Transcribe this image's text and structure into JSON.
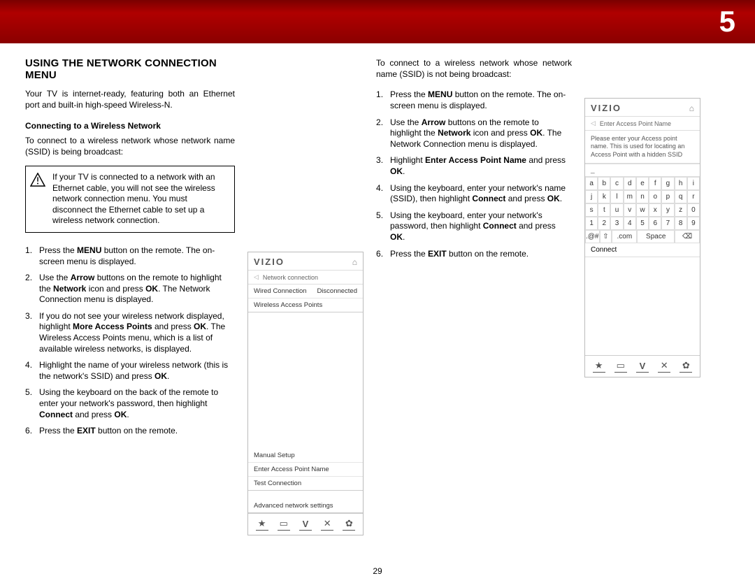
{
  "banner": {
    "chapter": "5"
  },
  "pageNumber": "29",
  "left": {
    "title": "USING THE NETWORK CONNECTION MENU",
    "intro": "Your TV is internet-ready, featuring both an Ethernet port and built-in high-speed Wireless-N.",
    "subhead": "Connecting to a Wireless Network",
    "lead": "To connect to a wireless network whose network name (SSID) is being broadcast:",
    "warning": "If your TV is connected to a network with an Ethernet cable, you will not see the wireless network connection menu. You must disconnect the Ethernet cable to set up a wireless network connection.",
    "steps": {
      "s1a": "Press the ",
      "s1b": "MENU",
      "s1c": " button on the remote. The on-screen menu is displayed.",
      "s2a": "Use the ",
      "s2b": "Arrow",
      "s2c": " buttons on the remote to highlight the ",
      "s2d": "Network",
      "s2e": " icon and press ",
      "s2f": "OK",
      "s2g": ". The Network Connection menu is displayed.",
      "s3a": "If you do not see your wireless network displayed, highlight ",
      "s3b": "More Access Points",
      "s3c": " and press ",
      "s3d": "OK",
      "s3e": ". The Wireless Access Points menu, which is a list of available wireless networks, is displayed.",
      "s4a": "Highlight the name of your wireless network (this is the network's SSID) and press ",
      "s4b": "OK",
      "s4c": ".",
      "s5a": "Using the keyboard on the back of the remote to enter your network's password, then highlight ",
      "s5b": "Connect",
      "s5c": " and press ",
      "s5d": "OK",
      "s5e": ".",
      "s6a": "Press the ",
      "s6b": "EXIT",
      "s6c": " button on the remote."
    }
  },
  "mid_menu": {
    "brand": "VIZIO",
    "crumb": "Network connection",
    "rows": {
      "wired_label": "Wired Connection",
      "wired_status": "Disconnected",
      "wireless": "Wireless Access Points"
    },
    "lower": {
      "manual": "Manual Setup",
      "enter_ap": "Enter Access Point Name",
      "test": "Test Connection",
      "advanced": "Advanced network settings"
    }
  },
  "right": {
    "lead": "To connect to a wireless network whose network name (SSID) is not being broadcast:",
    "steps": {
      "s1a": "Press the ",
      "s1b": "MENU",
      "s1c": " button on the remote. The on-screen menu is displayed.",
      "s2a": "Use the ",
      "s2b": "Arrow",
      "s2c": " buttons on the remote to highlight the ",
      "s2d": "Network",
      "s2e": " icon and press ",
      "s2f": "OK",
      "s2g": ". The Network Connection menu is displayed.",
      "s3a": "Highlight ",
      "s3b": "Enter Access Point Name",
      "s3c": " and press ",
      "s3d": "OK",
      "s3e": ".",
      "s4a": "Using the keyboard, enter your network's name (SSID), then highlight ",
      "s4b": "Connect",
      "s4c": " and press ",
      "s4d": "OK",
      "s4e": ".",
      "s5a": "Using the keyboard, enter your network's password, then highlight ",
      "s5b": "Connect",
      "s5c": " and press ",
      "s5d": "OK",
      "s5e": ".",
      "s6a": "Press the ",
      "s6b": "EXIT",
      "s6c": " button on the remote."
    }
  },
  "right_menu": {
    "brand": "VIZIO",
    "crumb": "Enter Access Point Name",
    "info": "Please enter your Access point name. This is used for locating an Access Point with a hidden SSID",
    "underscore": "_",
    "keys_row1": [
      "a",
      "b",
      "c",
      "d",
      "e",
      "f",
      "g",
      "h",
      "i"
    ],
    "keys_row2": [
      "j",
      "k",
      "l",
      "m",
      "n",
      "o",
      "p",
      "q",
      "r"
    ],
    "keys_row3": [
      "s",
      "t",
      "u",
      "v",
      "w",
      "x",
      "y",
      "z",
      "0"
    ],
    "keys_row4": [
      "1",
      "2",
      "3",
      "4",
      "5",
      "6",
      "7",
      "8",
      "9"
    ],
    "sym": ".@#",
    "shift": "⇧",
    "com": ".com",
    "space": "Space",
    "del": "⌫",
    "connect": "Connect"
  }
}
